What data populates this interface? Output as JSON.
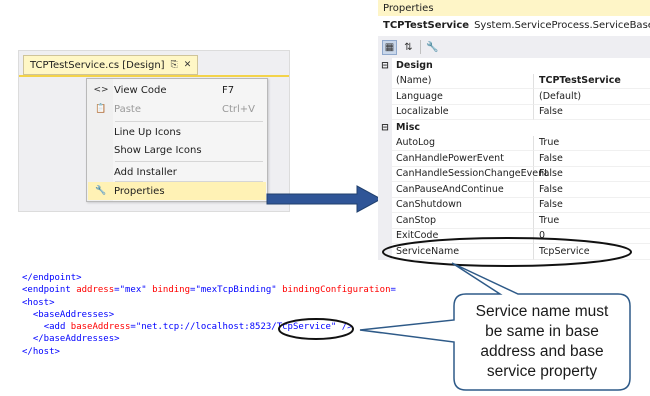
{
  "designer": {
    "tab_title": "TCPTestService.cs [Design]",
    "pin_icon": "pin-icon",
    "close_icon": "close-icon"
  },
  "context_menu": {
    "items": [
      {
        "label": "View Code",
        "shortcut": "F7",
        "icon": "view-code-icon",
        "disabled": false
      },
      {
        "label": "Paste",
        "shortcut": "Ctrl+V",
        "icon": "paste-icon",
        "disabled": true
      },
      {
        "label": "Line Up Icons",
        "shortcut": "",
        "icon": "",
        "disabled": false
      },
      {
        "label": "Show Large Icons",
        "shortcut": "",
        "icon": "",
        "disabled": false
      },
      {
        "label": "Add Installer",
        "shortcut": "",
        "icon": "",
        "disabled": false
      },
      {
        "label": "Properties",
        "shortcut": "",
        "icon": "wrench-icon",
        "disabled": false,
        "highlighted": true
      }
    ]
  },
  "properties": {
    "title": "Properties",
    "object_name": "TCPTestService",
    "object_type": "System.ServiceProcess.ServiceBase",
    "categories": [
      {
        "name": "Design",
        "rows": [
          {
            "name": "(Name)",
            "value": "TCPTestService",
            "bold": true
          },
          {
            "name": "Language",
            "value": "(Default)",
            "bold": false
          },
          {
            "name": "Localizable",
            "value": "False",
            "bold": false
          }
        ]
      },
      {
        "name": "Misc",
        "rows": [
          {
            "name": "AutoLog",
            "value": "True",
            "bold": false
          },
          {
            "name": "CanHandlePowerEvent",
            "value": "False",
            "bold": false
          },
          {
            "name": "CanHandleSessionChangeEvent",
            "value": "False",
            "bold": false
          },
          {
            "name": "CanPauseAndContinue",
            "value": "False",
            "bold": false
          },
          {
            "name": "CanShutdown",
            "value": "False",
            "bold": false
          },
          {
            "name": "CanStop",
            "value": "True",
            "bold": false
          },
          {
            "name": "ExitCode",
            "value": "0",
            "bold": false
          },
          {
            "name": "ServiceName",
            "value": "TcpService",
            "bold": true
          }
        ]
      }
    ]
  },
  "code": {
    "line0": "</endpoint>",
    "line1_tag": "<endpoint",
    "line1_attr1": "address",
    "line1_val1": "\"mex\"",
    "line1_attr2": "binding",
    "line1_val2": "\"mexTcpBinding\"",
    "line1_attr3": "bindingConfiguration",
    "line2": "<host>",
    "line3": "<baseAddresses>",
    "line4_tag": "<add",
    "line4_attr": "baseAddress",
    "line4_val1": "\"net.tcp://localhost:8523",
    "line4_val2": "/TcpService\"",
    "line4_end": "/>",
    "line5": "</baseAddresses>",
    "line6": "</host>"
  },
  "callout": {
    "line1": "Service name must",
    "line2": "be same in base",
    "line3": "address and base",
    "line4": "service property"
  },
  "colors": {
    "arrow": "#2f5597",
    "callout_border": "#2e5a88",
    "highlight": "#fff2b5"
  }
}
